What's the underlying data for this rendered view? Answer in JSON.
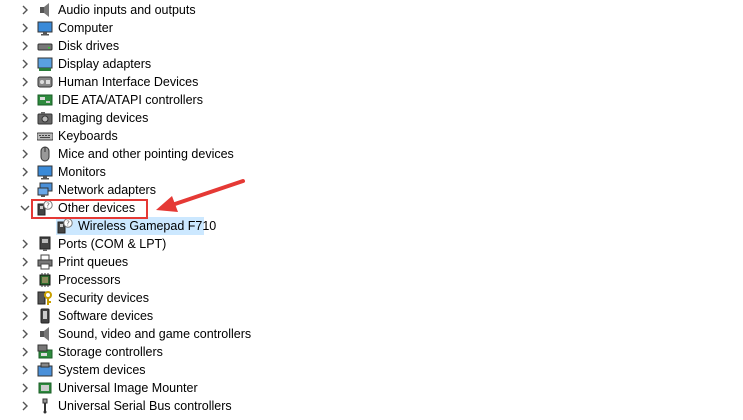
{
  "tree": {
    "items": [
      {
        "label": "Audio inputs and outputs",
        "icon": "speaker-icon",
        "expanded": false
      },
      {
        "label": "Computer",
        "icon": "monitor-icon",
        "expanded": false
      },
      {
        "label": "Disk drives",
        "icon": "disk-drive-icon",
        "expanded": false
      },
      {
        "label": "Display adapters",
        "icon": "display-adapter-icon",
        "expanded": false
      },
      {
        "label": "Human Interface Devices",
        "icon": "hid-icon",
        "expanded": false
      },
      {
        "label": "IDE ATA/ATAPI controllers",
        "icon": "ide-controller-icon",
        "expanded": false
      },
      {
        "label": "Imaging devices",
        "icon": "camera-icon",
        "expanded": false
      },
      {
        "label": "Keyboards",
        "icon": "keyboard-icon",
        "expanded": false
      },
      {
        "label": "Mice and other pointing devices",
        "icon": "mouse-icon",
        "expanded": false
      },
      {
        "label": "Monitors",
        "icon": "monitor-icon",
        "expanded": false
      },
      {
        "label": "Network adapters",
        "icon": "network-adapter-icon",
        "expanded": false
      },
      {
        "label": "Other devices",
        "icon": "unknown-device-icon",
        "expanded": true,
        "children": [
          {
            "label": "Wireless Gamepad F710",
            "icon": "unknown-device-icon",
            "selected": true
          }
        ]
      },
      {
        "label": "Ports (COM & LPT)",
        "icon": "port-icon",
        "expanded": false
      },
      {
        "label": "Print queues",
        "icon": "printer-icon",
        "expanded": false
      },
      {
        "label": "Processors",
        "icon": "processor-icon",
        "expanded": false
      },
      {
        "label": "Security devices",
        "icon": "security-key-icon",
        "expanded": false
      },
      {
        "label": "Software devices",
        "icon": "software-device-icon",
        "expanded": false
      },
      {
        "label": "Sound, video and game controllers",
        "icon": "speaker-icon",
        "expanded": false
      },
      {
        "label": "Storage controllers",
        "icon": "storage-controller-icon",
        "expanded": false
      },
      {
        "label": "System devices",
        "icon": "system-device-icon",
        "expanded": false
      },
      {
        "label": "Universal Image Mounter",
        "icon": "image-mounter-icon",
        "expanded": false
      },
      {
        "label": "Universal Serial Bus controllers",
        "icon": "usb-icon",
        "expanded": false
      }
    ]
  },
  "annotation": {
    "color": "#e53935"
  },
  "colors": {
    "selection": "#cce8ff",
    "chevron": "#555555"
  }
}
